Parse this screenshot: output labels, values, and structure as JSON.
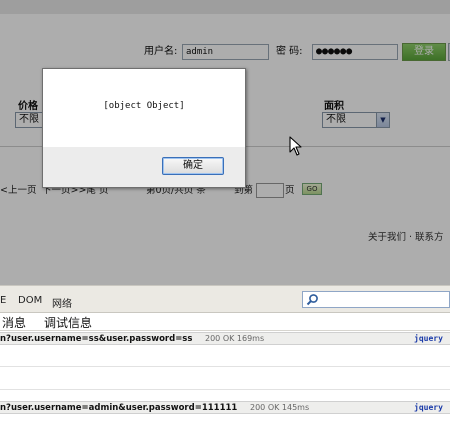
{
  "login": {
    "username_label": "用户名:",
    "username_value": "admin",
    "password_label": "密  码:",
    "password_value": "●●●●●●",
    "submit_label": "登录"
  },
  "filters": [
    {
      "label": "价格",
      "selected": "不限"
    },
    {
      "label": "面积",
      "selected": "不限"
    }
  ],
  "pager": {
    "prev": "<上一页",
    "next_last": "下一页>>尾 页",
    "page_info": "第0页/共页 条",
    "goto_label": "到第",
    "page_suffix": "页",
    "go_label": "GO"
  },
  "footer": {
    "links": "关于我们 · 联系方"
  },
  "dialog": {
    "message": "[object Object]",
    "ok_label": "确定"
  },
  "firebug": {
    "tabs": [
      "DOM",
      "网络"
    ],
    "tab_prefix": "E",
    "subtabs": [
      "消息",
      "调试信息"
    ],
    "requests": [
      {
        "url": "n?user.username=ss&user.password=ss",
        "status": "200 OK 169ms",
        "source": "jquery"
      },
      {
        "url": "n?user.username=admin&user.password=111111",
        "status": "200 OK 145ms",
        "source": "jquery"
      }
    ]
  },
  "colors": {
    "overlay": "#000000",
    "login_button": "#5aa63a",
    "source_link": "#1a3aa8"
  }
}
